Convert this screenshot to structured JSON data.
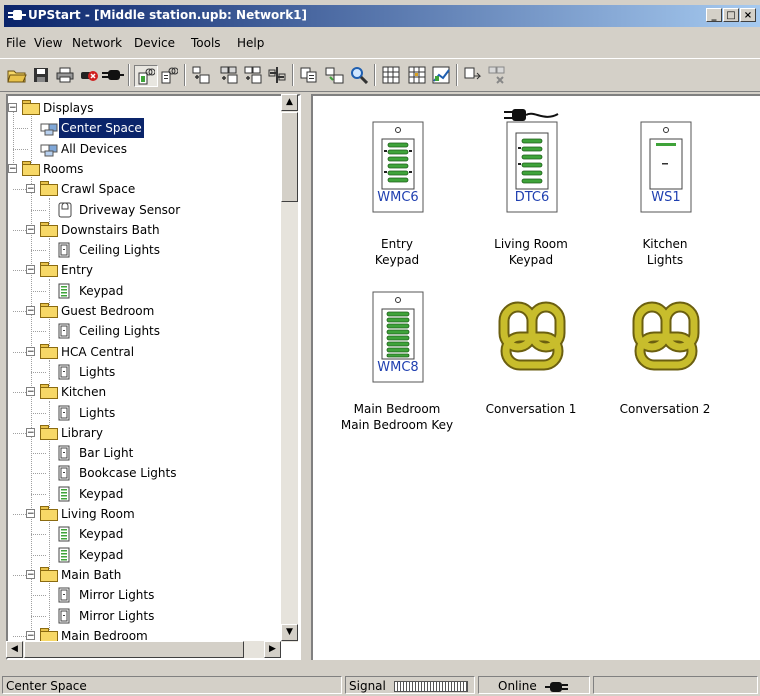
{
  "window": {
    "title": "UPStart - [Middle station.upb: Network1]"
  },
  "menu": {
    "items": [
      "File",
      "View",
      "Network",
      "Device",
      "Tools",
      "Help"
    ]
  },
  "tree": {
    "rows": [
      {
        "label": "Displays",
        "type": "folder"
      },
      {
        "label": "Center Space",
        "type": "display"
      },
      {
        "label": "All Devices",
        "type": "display"
      },
      {
        "label": "Rooms",
        "type": "folder"
      },
      {
        "label": "Crawl Space",
        "type": "folder"
      },
      {
        "label": "Driveway Sensor",
        "type": "sensor"
      },
      {
        "label": "Downstairs Bath",
        "type": "folder"
      },
      {
        "label": "Ceiling Lights",
        "type": "switch"
      },
      {
        "label": "Entry",
        "type": "folder"
      },
      {
        "label": "Keypad",
        "type": "keypad"
      },
      {
        "label": "Guest Bedroom",
        "type": "folder"
      },
      {
        "label": "Ceiling Lights",
        "type": "switch"
      },
      {
        "label": "HCA Central",
        "type": "folder"
      },
      {
        "label": "Lights",
        "type": "switch"
      },
      {
        "label": "Kitchen",
        "type": "folder"
      },
      {
        "label": "Lights",
        "type": "switch"
      },
      {
        "label": "Library",
        "type": "folder"
      },
      {
        "label": "Bar Light",
        "type": "switch"
      },
      {
        "label": "Bookcase Lights",
        "type": "switch"
      },
      {
        "label": "Keypad",
        "type": "keypad"
      },
      {
        "label": "Living Room",
        "type": "folder"
      },
      {
        "label": "Keypad",
        "type": "keypad"
      },
      {
        "label": "Keypad",
        "type": "keypad"
      },
      {
        "label": "Main Bath",
        "type": "folder"
      },
      {
        "label": "Mirror Lights",
        "type": "switch"
      },
      {
        "label": "Mirror Lights",
        "type": "switch"
      },
      {
        "label": "Main Bedroom",
        "type": "folder"
      }
    ]
  },
  "devices": [
    {
      "model": "WMC6",
      "line1": "Entry",
      "line2": "Keypad"
    },
    {
      "model": "DTC6",
      "line1": "Living Room",
      "line2": "Keypad"
    },
    {
      "model": "WS1",
      "line1": "Kitchen",
      "line2": "Lights"
    },
    {
      "model": "WMC8",
      "line1": "Main Bedroom",
      "line2": "Main Bedroom Key"
    },
    {
      "model": "",
      "line1": "Conversation 1",
      "line2": ""
    },
    {
      "model": "",
      "line1": "Conversation 2",
      "line2": ""
    }
  ],
  "status": {
    "left": "Center Space",
    "signal_label": "Signal",
    "online_label": "Online"
  },
  "colors": {
    "title_start": "#0a246a",
    "title_end": "#a6caf0",
    "device_blue": "#1f3fb0",
    "led_green": "#3fa33a",
    "link_gold": "#b8a824"
  }
}
